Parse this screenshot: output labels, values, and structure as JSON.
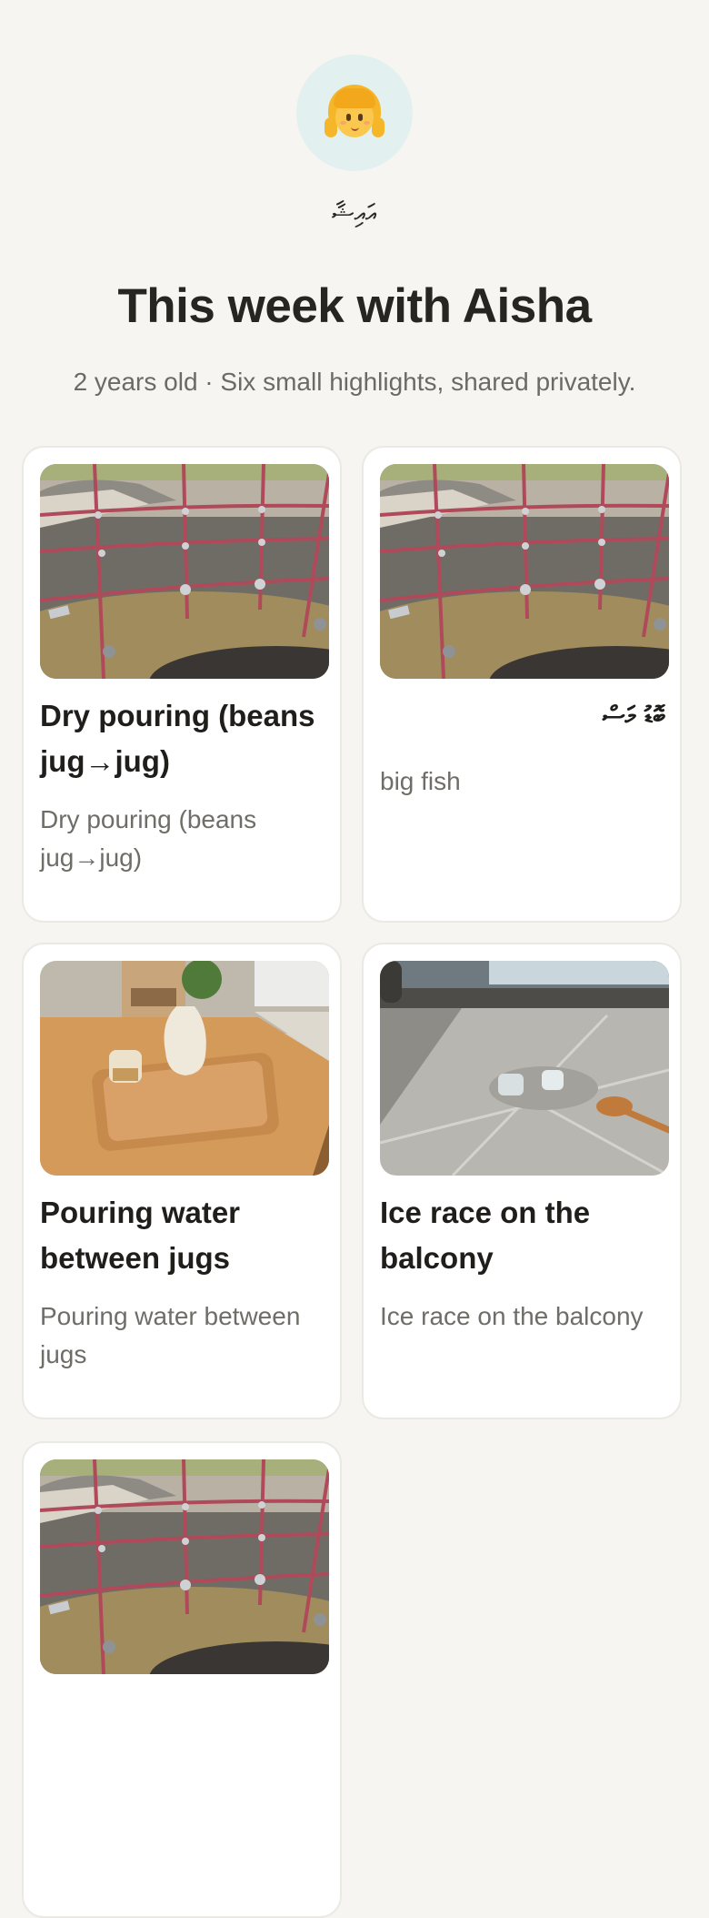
{
  "profile": {
    "avatar": "girl-emoji-icon",
    "script_name": "އައިޝާ",
    "title": "This week with Aisha",
    "subtitle": "2 years old · Six small highlights, shared privately."
  },
  "highlights": [
    {
      "title": "Dry pouring (beans jug→jug)",
      "description": "Dry pouring (beans jug→jug)",
      "photo": "playground-rope-net"
    },
    {
      "title": "ބޮޑު މަސް",
      "description": "big fish",
      "photo": "playground-rope-net"
    },
    {
      "title": "Pouring water between jugs",
      "description": "Pouring water between jugs",
      "photo": "wooden-tray-jug-cup"
    },
    {
      "title": "Ice race on the balcony",
      "description": "Ice race on the balcony",
      "photo": "balcony-ice-spoon"
    },
    {
      "title": "",
      "description": "",
      "photo": "playground-rope-net"
    }
  ],
  "colors": {
    "background": "#f6f5f1",
    "card": "#ffffff",
    "avatar_bg": "#e2f1ef",
    "title": "#262520",
    "muted": "#6b6a65"
  }
}
